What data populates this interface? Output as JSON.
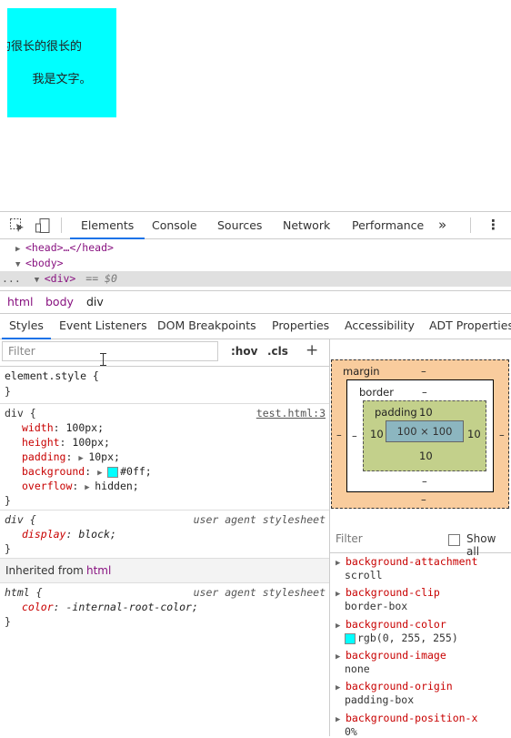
{
  "page": {
    "box_line1": "长的很长的很长的",
    "box_line2": "我是文字。",
    "box_color": "#00ffff"
  },
  "devtools": {
    "tabs": [
      "Elements",
      "Console",
      "Sources",
      "Network",
      "Performance"
    ],
    "more_tabs_icon": "»",
    "menu_icon": "⋮",
    "dom": {
      "head": "<head>…</head>",
      "body": "<body>",
      "div": "<div>",
      "selected_marker": "== $0",
      "ellipsis": "..."
    },
    "breadcrumbs": [
      "html",
      "body",
      "div"
    ],
    "subtabs": [
      "Styles",
      "Event Listeners",
      "DOM Breakpoints",
      "Properties",
      "Accessibility",
      "ADT Properties"
    ],
    "filter_placeholder": "Filter",
    "hov": ":hov",
    "cls": ".cls",
    "plus": "+",
    "rules": {
      "element_style": {
        "selector": "element.style {",
        "close": "}"
      },
      "div": {
        "selector": "div {",
        "source": "test.html:3",
        "declarations": [
          {
            "prop": "width",
            "value": "100px;"
          },
          {
            "prop": "height",
            "value": "100px;"
          },
          {
            "prop": "padding",
            "value": "10px;"
          },
          {
            "prop": "background",
            "value": "#0ff;"
          },
          {
            "prop": "overflow",
            "value": "hidden;"
          }
        ],
        "close": "}"
      },
      "div_ua": {
        "selector": "div {",
        "source": "user agent stylesheet",
        "prop": "display",
        "value": "block;",
        "close": "}"
      },
      "inherited": {
        "label": "Inherited from",
        "tag": "html"
      },
      "html_ua": {
        "selector": "html {",
        "source": "user agent stylesheet",
        "prop": "color",
        "value": "-internal-root-color;",
        "close": "}"
      }
    },
    "box_model": {
      "margin_label": "margin",
      "margin_value": "–",
      "border_label": "border",
      "border_value": "–",
      "padding_label": "padding",
      "padding_value": "10",
      "padding_left": "10",
      "padding_right": "10",
      "padding_bottom": "10",
      "content": "100 × 100",
      "dash": "–"
    },
    "computed": {
      "filter_placeholder": "Filter",
      "show_all": "Show all",
      "items": [
        {
          "prop": "background-attachment",
          "value": "scroll"
        },
        {
          "prop": "background-clip",
          "value": "border-box"
        },
        {
          "prop": "background-color",
          "value": "rgb(0, 255, 255)"
        },
        {
          "prop": "background-image",
          "value": "none"
        },
        {
          "prop": "background-origin",
          "value": "padding-box"
        },
        {
          "prop": "background-position-x",
          "value": "0%"
        }
      ]
    }
  }
}
